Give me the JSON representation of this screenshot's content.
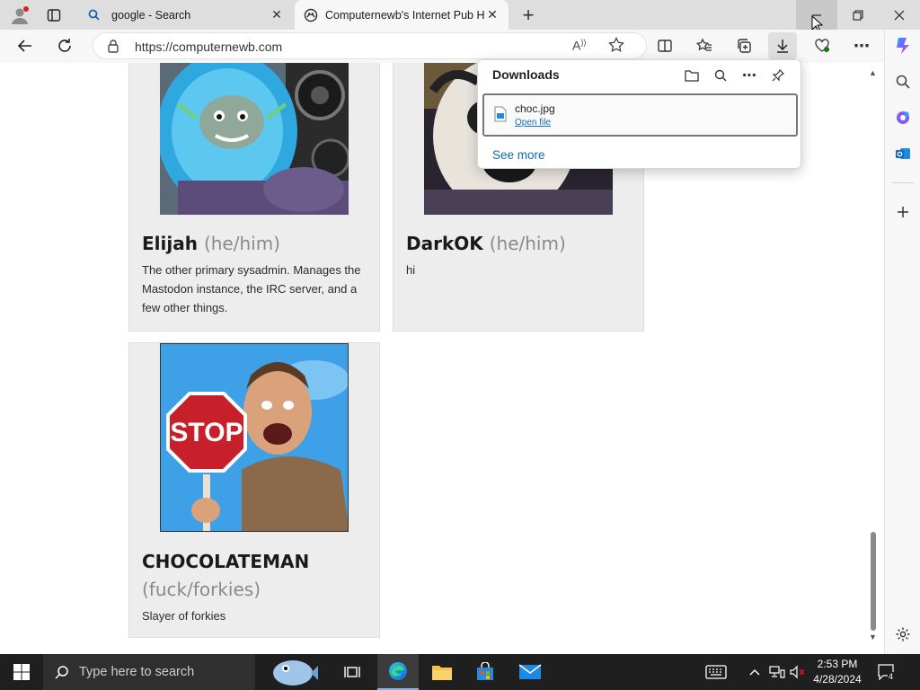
{
  "browser": {
    "tabs": [
      {
        "label": "google - Search",
        "icon": "search-icon",
        "active": false
      },
      {
        "label": "Computernewb's Internet Pub Hub",
        "icon": "site-favicon",
        "active": true
      }
    ],
    "new_tab_symbol": "+",
    "address": {
      "url": "https://computernewb.com"
    }
  },
  "downloads": {
    "title": "Downloads",
    "item": {
      "filename": "choc.jpg",
      "action": "Open file"
    },
    "see_more": "See more"
  },
  "cards": [
    {
      "name": "Elijah",
      "pronouns": "(he/him)",
      "description": "The other primary sysadmin. Manages the Mastodon instance, the IRC server, and a few other things."
    },
    {
      "name": "DarkOK",
      "pronouns": "(he/him)",
      "description": "hi"
    },
    {
      "name": "CHOCOLATEMAN",
      "pronouns": "(fuck/forkies)",
      "description": "Slayer of forkies"
    }
  ],
  "taskbar": {
    "search_placeholder": "Type here to search",
    "time": "2:53 PM",
    "date": "4/28/2024",
    "notification_count": "4"
  },
  "colors": {
    "accent": "#0f6cbd",
    "card_bg": "#ededed",
    "taskbar": "#1f1f1f"
  }
}
